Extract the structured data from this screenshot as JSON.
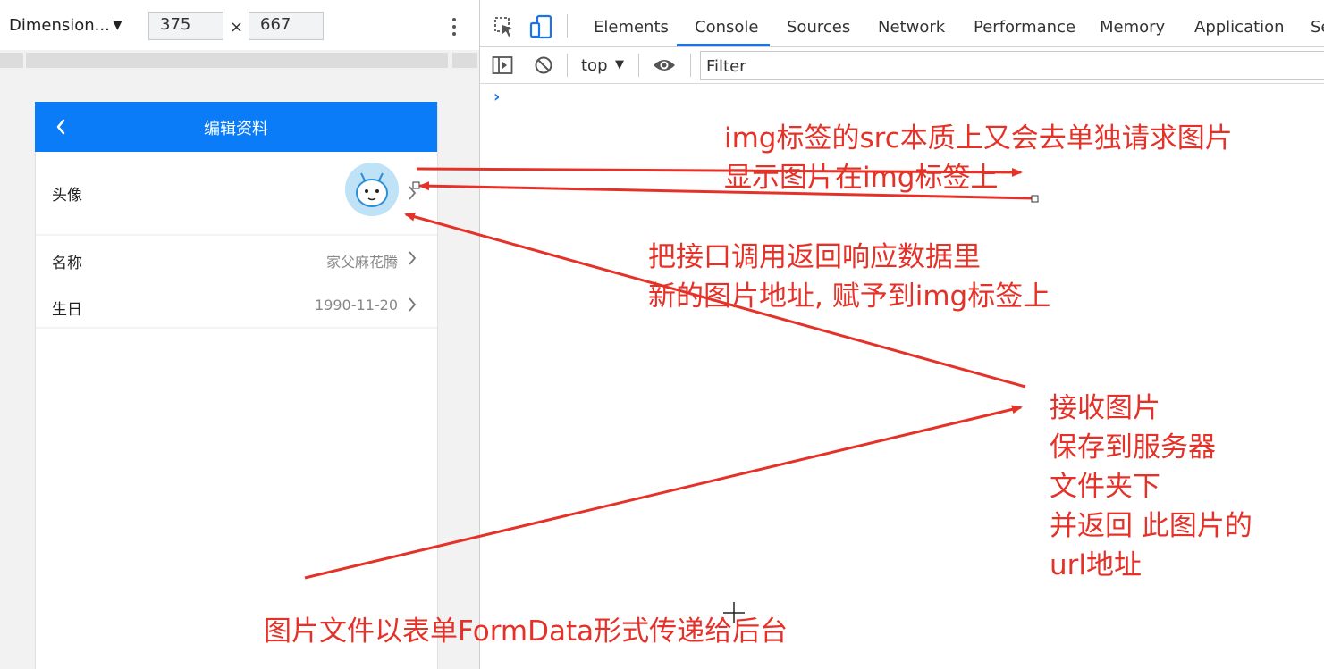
{
  "device_toolbar": {
    "dimension_label": "Dimension...",
    "width": "375",
    "height": "667",
    "times": "×"
  },
  "phone": {
    "title": "编辑资料",
    "rows": [
      {
        "label": "头像",
        "value": ""
      },
      {
        "label": "名称",
        "value": "家父麻花腾"
      },
      {
        "label": "生日",
        "value": "1990-11-20"
      }
    ]
  },
  "devtools": {
    "tabs": [
      "Elements",
      "Console",
      "Sources",
      "Network",
      "Performance",
      "Memory",
      "Application",
      "Se"
    ],
    "active_tab": "Console",
    "context": "top",
    "filter_placeholder": "Filter",
    "prompt": "›",
    "accent_color": "#1a73e8"
  },
  "annotations": {
    "top": "img标签的src本质上又会去单独请求图片\n显示图片在img标签上",
    "middle": "把接口调用返回响应数据里\n新的图片地址, 赋予到img标签上",
    "right": "接收图片\n保存到服务器\n文件夹下\n并返回 此图片的\nurl地址",
    "bottom": "图片文件以表单FormData形式传递给后台",
    "color": "#e53229"
  },
  "colors": {
    "header_blue": "#0a7cf7"
  }
}
